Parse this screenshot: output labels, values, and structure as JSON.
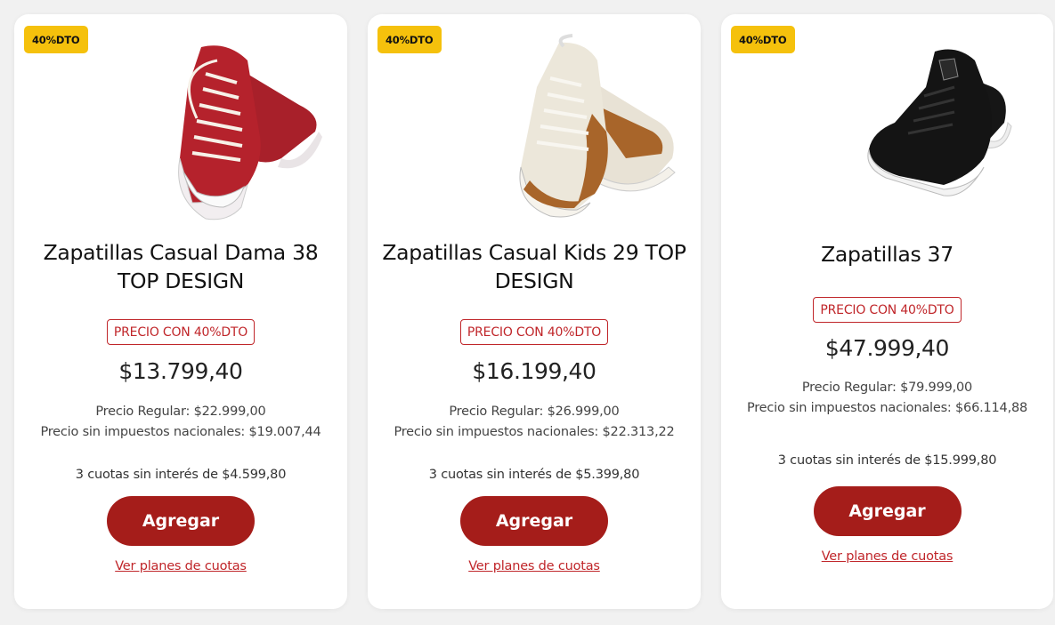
{
  "products": [
    {
      "badge": "40%DTO",
      "title": "Zapatillas Casual Dama 38 TOP DESIGN",
      "discount_tag": "PRECIO CON 40%DTO",
      "price": "$13.799,40",
      "regular_price": "Precio Regular: $22.999,00",
      "no_tax_price": "Precio sin impuestos nacionales: $19.007,44",
      "installments": "3 cuotas sin interés de $4.599,80",
      "add_label": "Agregar",
      "plans_link": "Ver planes de cuotas",
      "image_icon": "red-canvas-sneakers-image"
    },
    {
      "badge": "40%DTO",
      "title": "Zapatillas Casual Kids 29 TOP DESIGN",
      "discount_tag": "PRECIO CON 40%DTO",
      "price": "$16.199,40",
      "regular_price": "Precio Regular: $26.999,00",
      "no_tax_price": "Precio sin impuestos nacionales: $22.313,22",
      "installments": "3 cuotas sin interés de $5.399,80",
      "add_label": "Agregar",
      "plans_link": "Ver planes de cuotas",
      "image_icon": "beige-brown-sneakers-image"
    },
    {
      "badge": "40%DTO",
      "title": "Zapatillas 37",
      "discount_tag": "PRECIO CON 40%DTO",
      "price": "$47.999,40",
      "regular_price": "Precio Regular: $79.999,00",
      "no_tax_price": "Precio sin impuestos nacionales: $66.114,88",
      "installments": "3 cuotas sin interés de $15.999,80",
      "add_label": "Agregar",
      "plans_link": "Ver planes de cuotas",
      "image_icon": "black-suede-sneakers-image"
    }
  ],
  "colors": {
    "badge_bg": "#f5c10c",
    "button_bg": "#a51d1a",
    "accent_red": "#c0262a"
  }
}
